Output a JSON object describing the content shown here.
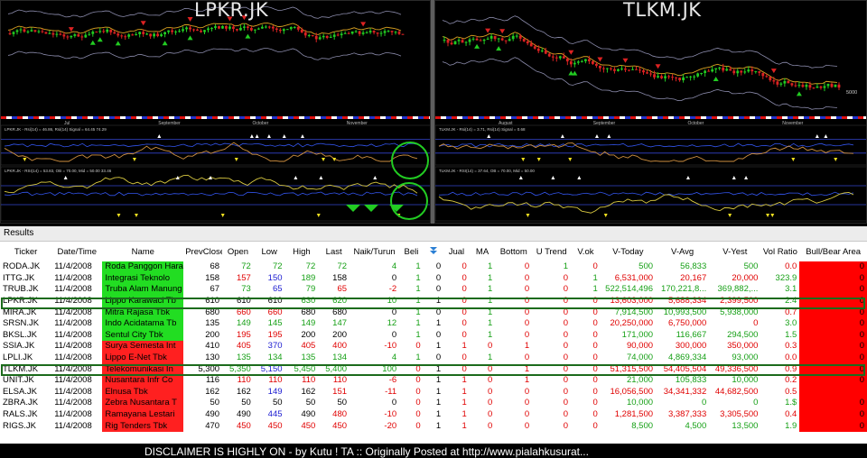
{
  "charts": {
    "left_title": "LPKR.JK",
    "right_title": "TLKM.JK",
    "left_months": [
      "Jul",
      "September",
      "October",
      "November"
    ],
    "right_months": [
      "August",
      "September",
      "October",
      "November"
    ],
    "left_ind1_label": "LPKR.JK - Rsi(14) = 46.86, Rsi(14) Signal = 64.45",
    "left_ind1_value": "74.29",
    "left_ind2_label": "LPKR.JK - RSI(14) = 53.83, OB = 70.00, Mid = 50.00",
    "left_ind2_value": "33.46",
    "right_ind1_label": "TLKM.JK - Rsi(14) = 3.71, Rsi(14) Signal = 0.68",
    "right_ind2_label": "TLKM.JK - RSI(14) = 37.64, OB = 70.00, Mid = 50.00",
    "right_price_tick": "5000",
    "candle_up_color": "#22cc22",
    "candle_down_color": "#dd2222",
    "highlight_circle_color": "#22cc22"
  },
  "results": {
    "title": "Results",
    "headers": [
      "Ticker",
      "Date/Time",
      "Name",
      "PrevClose",
      "Open",
      "Low",
      "High",
      "Last",
      "Naik/Turun",
      "Beli",
      "",
      "Jual",
      "MA",
      "Bottom",
      "U Trend",
      "V.ok",
      "V-Today",
      "V-Avg",
      "V-Yest",
      "Vol Ratio",
      "Bull/Bear Area"
    ],
    "rows": [
      {
        "ticker": "RODA.JK",
        "date": "11/4/2008",
        "name": "Roda Panggon Hara",
        "name_color": "green",
        "prev": "68",
        "open": "72",
        "low": "72",
        "high": "72",
        "last": "72",
        "chg": "4",
        "beli": "1",
        "x": "0",
        "jual": "0",
        "ma": "1",
        "bottom": "0",
        "utrend": "1",
        "vok": "0",
        "vtoday": "500",
        "vavg": "56,833",
        "vyest": "500",
        "volratio": "0.0",
        "bb": "0",
        "c": {
          "open": "g",
          "low": "g",
          "high": "g",
          "last": "g",
          "chg": "g"
        }
      },
      {
        "ticker": "ITTG.JK",
        "date": "11/4/2008",
        "name": "Integrasi Teknolo",
        "name_color": "green",
        "prev": "158",
        "open": "157",
        "low": "150",
        "high": "189",
        "last": "158",
        "chg": "0",
        "beli": "1",
        "x": "0",
        "jual": "0",
        "ma": "1",
        "bottom": "0",
        "utrend": "0",
        "vok": "1",
        "vtoday": "6,531,000",
        "vavg": "20,167",
        "vyest": "20,000",
        "volratio": "323.9",
        "bb": "0",
        "c": {
          "open": "r",
          "low": "b",
          "high": "g",
          "last": "k",
          "chg": "k"
        }
      },
      {
        "ticker": "TRUB.JK",
        "date": "11/4/2008",
        "name": "Truba Alam Manung",
        "name_color": "green",
        "prev": "67",
        "open": "73",
        "low": "65",
        "high": "79",
        "last": "65",
        "chg": "-2",
        "beli": "1",
        "x": "0",
        "jual": "0",
        "ma": "1",
        "bottom": "0",
        "utrend": "0",
        "vok": "1",
        "vtoday": "522,514,496",
        "vavg": "170,221,8...",
        "vyest": "369,882,...",
        "volratio": "3.1",
        "bb": "0",
        "c": {
          "open": "g",
          "low": "b",
          "high": "g",
          "last": "r",
          "chg": "r"
        }
      },
      {
        "ticker": "LPKR.JK",
        "date": "11/4/2008",
        "name": "Lippo Karawaci Tb",
        "name_color": "green",
        "prev": "610",
        "open": "610",
        "low": "610",
        "high": "630",
        "last": "620",
        "chg": "10",
        "beli": "1",
        "x": "1",
        "jual": "0",
        "ma": "1",
        "bottom": "0",
        "utrend": "0",
        "vok": "0",
        "vtoday": "13,603,000",
        "vavg": "5,688,334",
        "vyest": "2,399,500",
        "volratio": "2.4",
        "bb": "0",
        "c": {
          "open": "k",
          "low": "k",
          "high": "g",
          "last": "g",
          "chg": "g"
        }
      },
      {
        "ticker": "MIRA.JK",
        "date": "11/4/2008",
        "name": "Mitra Rajasa Tbk",
        "name_color": "green",
        "prev": "680",
        "open": "660",
        "low": "660",
        "high": "680",
        "last": "680",
        "chg": "0",
        "beli": "1",
        "x": "0",
        "jual": "0",
        "ma": "1",
        "bottom": "0",
        "utrend": "0",
        "vok": "0",
        "vtoday": "7,914,500",
        "vavg": "10,993,500",
        "vyest": "5,938,000",
        "volratio": "0.7",
        "bb": "0",
        "c": {
          "open": "r",
          "low": "r",
          "high": "k",
          "last": "k",
          "chg": "k"
        }
      },
      {
        "ticker": "SRSN.JK",
        "date": "11/4/2008",
        "name": "Indo Acidatama Tb",
        "name_color": "green",
        "prev": "135",
        "open": "149",
        "low": "145",
        "high": "149",
        "last": "147",
        "chg": "12",
        "beli": "1",
        "x": "1",
        "jual": "0",
        "ma": "1",
        "bottom": "0",
        "utrend": "0",
        "vok": "0",
        "vtoday": "20,250,000",
        "vavg": "6,750,000",
        "vyest": "0",
        "volratio": "3.0",
        "bb": "0",
        "c": {
          "open": "g",
          "low": "g",
          "high": "g",
          "last": "g",
          "chg": "g"
        }
      },
      {
        "ticker": "BKSL.JK",
        "date": "11/4/2008",
        "name": "Sentul City Tbk",
        "name_color": "green",
        "prev": "200",
        "open": "195",
        "low": "195",
        "high": "200",
        "last": "200",
        "chg": "0",
        "beli": "1",
        "x": "0",
        "jual": "0",
        "ma": "1",
        "bottom": "0",
        "utrend": "0",
        "vok": "0",
        "vtoday": "171,000",
        "vavg": "116,667",
        "vyest": "294,500",
        "volratio": "1.5",
        "bb": "0",
        "c": {
          "open": "r",
          "low": "r",
          "high": "k",
          "last": "k",
          "chg": "k"
        }
      },
      {
        "ticker": "SSIA.JK",
        "date": "11/4/2008",
        "name": "Surya Semesta Int",
        "name_color": "red",
        "prev": "410",
        "open": "405",
        "low": "370",
        "high": "405",
        "last": "400",
        "chg": "-10",
        "beli": "0",
        "x": "1",
        "jual": "1",
        "ma": "0",
        "bottom": "1",
        "utrend": "0",
        "vok": "0",
        "vtoday": "90,000",
        "vavg": "300,000",
        "vyest": "350,000",
        "volratio": "0.3",
        "bb": "0",
        "c": {
          "open": "r",
          "low": "b",
          "high": "r",
          "last": "r",
          "chg": "r"
        }
      },
      {
        "ticker": "LPLI.JK",
        "date": "11/4/2008",
        "name": "Lippo E-Net Tbk",
        "name_color": "red",
        "prev": "130",
        "open": "135",
        "low": "134",
        "high": "135",
        "last": "134",
        "chg": "4",
        "beli": "1",
        "x": "0",
        "jual": "0",
        "ma": "1",
        "bottom": "0",
        "utrend": "0",
        "vok": "0",
        "vtoday": "74,000",
        "vavg": "4,869,334",
        "vyest": "93,000",
        "volratio": "0.0",
        "bb": "0",
        "c": {
          "open": "g",
          "low": "g",
          "high": "g",
          "last": "g",
          "chg": "g"
        }
      },
      {
        "ticker": "TLKM.JK",
        "date": "11/4/2008",
        "name": "Telekomunikasi In",
        "name_color": "red",
        "prev": "5,300",
        "open": "5,350",
        "low": "5,150",
        "high": "5,450",
        "last": "5,400",
        "chg": "100",
        "beli": "0",
        "x": "1",
        "jual": "0",
        "ma": "0",
        "bottom": "1",
        "utrend": "0",
        "vok": "0",
        "vtoday": "51,315,500",
        "vavg": "54,405,504",
        "vyest": "49,336,500",
        "volratio": "0.9",
        "bb": "0",
        "c": {
          "open": "g",
          "low": "b",
          "high": "g",
          "last": "g",
          "chg": "g"
        }
      },
      {
        "ticker": "UNIT.JK",
        "date": "11/4/2008",
        "name": "Nusantara Infr Co",
        "name_color": "red",
        "prev": "116",
        "open": "110",
        "low": "110",
        "high": "110",
        "last": "110",
        "chg": "-6",
        "beli": "0",
        "x": "1",
        "jual": "1",
        "ma": "0",
        "bottom": "1",
        "utrend": "0",
        "vok": "0",
        "vtoday": "21,000",
        "vavg": "105,833",
        "vyest": "10,000",
        "volratio": "0.2",
        "bb": "0",
        "c": {
          "open": "r",
          "low": "r",
          "high": "r",
          "last": "r",
          "chg": "r"
        }
      },
      {
        "ticker": "ELSA.JK",
        "date": "11/4/2008",
        "name": "Elnusa Tbk",
        "name_color": "red",
        "prev": "162",
        "open": "162",
        "low": "149",
        "high": "162",
        "last": "151",
        "chg": "-11",
        "beli": "0",
        "x": "1",
        "jual": "1",
        "ma": "0",
        "bottom": "0",
        "utrend": "0",
        "vok": "0",
        "vtoday": "16,056,500",
        "vavg": "34,341,332",
        "vyest": "44,682,500",
        "volratio": "0.5",
        "bb": "",
        "c": {
          "open": "k",
          "low": "b",
          "high": "k",
          "last": "r",
          "chg": "r"
        }
      },
      {
        "ticker": "ZBRA.JK",
        "date": "11/4/2008",
        "name": "Zebra Nusantara T",
        "name_color": "red",
        "prev": "50",
        "open": "50",
        "low": "50",
        "high": "50",
        "last": "50",
        "chg": "0",
        "beli": "0",
        "x": "1",
        "jual": "1",
        "ma": "0",
        "bottom": "0",
        "utrend": "0",
        "vok": "0",
        "vtoday": "10,000",
        "vavg": "0",
        "vyest": "0",
        "volratio": "1.$",
        "bb": "0",
        "c": {
          "open": "k",
          "low": "k",
          "high": "k",
          "last": "k",
          "chg": "k"
        }
      },
      {
        "ticker": "RALS.JK",
        "date": "11/4/2008",
        "name": "Ramayana Lestari",
        "name_color": "red",
        "prev": "490",
        "open": "490",
        "low": "445",
        "high": "490",
        "last": "480",
        "chg": "-10",
        "beli": "0",
        "x": "1",
        "jual": "1",
        "ma": "0",
        "bottom": "0",
        "utrend": "0",
        "vok": "0",
        "vtoday": "1,281,500",
        "vavg": "3,387,333",
        "vyest": "3,305,500",
        "volratio": "0.4",
        "bb": "0",
        "c": {
          "open": "k",
          "low": "b",
          "high": "k",
          "last": "r",
          "chg": "r"
        }
      },
      {
        "ticker": "RIGS.JK",
        "date": "11/4/2008",
        "name": "Rig Tenders Tbk",
        "name_color": "red",
        "prev": "470",
        "open": "450",
        "low": "450",
        "high": "450",
        "last": "450",
        "chg": "-20",
        "beli": "0",
        "x": "1",
        "jual": "1",
        "ma": "0",
        "bottom": "0",
        "utrend": "0",
        "vok": "0",
        "vtoday": "8,500",
        "vavg": "4,500",
        "vyest": "13,500",
        "volratio": "1.9",
        "bb": "0",
        "c": {
          "open": "r",
          "low": "r",
          "high": "r",
          "last": "r",
          "chg": "r"
        }
      }
    ]
  },
  "disclaimer": "DISCLAIMER IS HIGHLY ON - by Kutu ! TA :: Originally Posted at http://www.pialahkusurat..."
}
